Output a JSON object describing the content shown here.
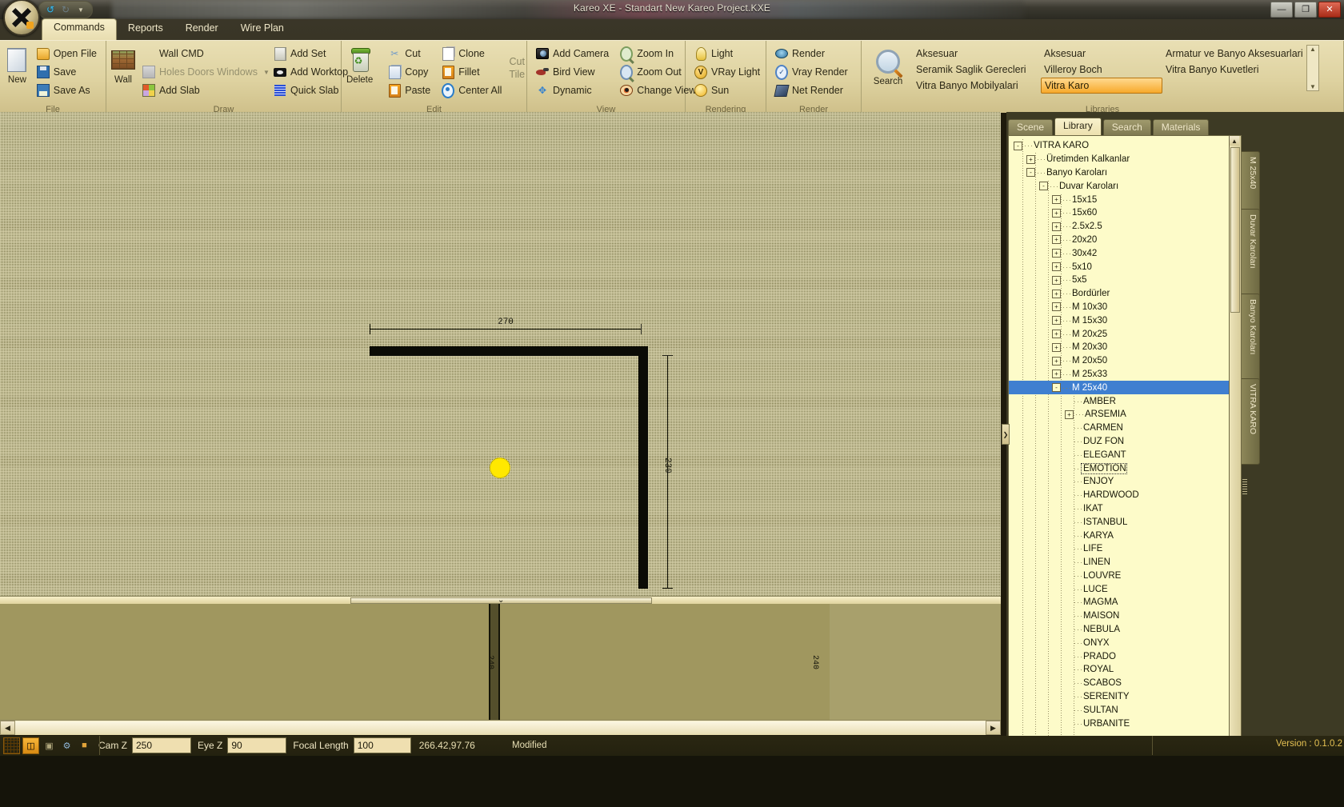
{
  "window": {
    "title": "Kareo XE - Standart  New Kareo Project.KXE",
    "buttons": {
      "minimize": "—",
      "maximize": "❐",
      "close": "✕"
    },
    "quick_access": {
      "undo": "↺",
      "redo": "↻",
      "more": "▼"
    }
  },
  "ribbon": {
    "tabs": [
      {
        "label": "Commands",
        "active": true
      },
      {
        "label": "Reports",
        "active": false
      },
      {
        "label": "Render",
        "active": false
      },
      {
        "label": "Wire Plan",
        "active": false
      }
    ],
    "groups": [
      {
        "name": "File",
        "label": "File",
        "big": {
          "label": "New",
          "icon": "new-document-icon"
        },
        "items": [
          {
            "label": "Open File",
            "icon": "open-folder-icon"
          },
          {
            "label": "Save",
            "icon": "floppy-disk-icon"
          },
          {
            "label": "Save As",
            "icon": "floppy-disk-plus-icon"
          }
        ]
      },
      {
        "name": "Draw",
        "label": "Draw",
        "big": {
          "label": "Wall",
          "icon": "brick-wall-icon"
        },
        "col1": [
          {
            "label": "Wall CMD",
            "icon": "none",
            "disabled": false
          },
          {
            "label": "Holes Doors Windows",
            "icon": "window-icon",
            "disabled": true,
            "caret": "▼"
          },
          {
            "label": "Add Slab",
            "icon": "slab-color-icon",
            "disabled": false
          }
        ],
        "col2": [
          {
            "label": "Add Set",
            "icon": "box-set-icon"
          },
          {
            "label": "Add Worktop",
            "icon": "worktop-icon"
          },
          {
            "label": "Quick Slab",
            "icon": "quick-slab-grid-icon"
          }
        ]
      },
      {
        "name": "Edit",
        "label": "Edit",
        "big": {
          "label": "Delete",
          "icon": "recycle-bin-icon"
        },
        "col1": [
          {
            "label": "Cut",
            "icon": "scissors-icon"
          },
          {
            "label": "Copy",
            "icon": "copy-pages-icon"
          },
          {
            "label": "Paste",
            "icon": "clipboard-icon"
          }
        ],
        "col2": [
          {
            "label": "Clone",
            "icon": "clone-icon"
          },
          {
            "label": "Fillet",
            "icon": "fillet-clipboard-icon"
          },
          {
            "label": "Center All",
            "icon": "center-target-icon"
          }
        ],
        "extra": {
          "line1": "Cut",
          "line2": "Tile"
        }
      },
      {
        "name": "View",
        "label": "View",
        "col1": [
          {
            "label": "Add Camera",
            "icon": "camera-icon"
          },
          {
            "label": "Bird View",
            "icon": "bird-icon"
          },
          {
            "label": "Dynamic",
            "icon": "move-arrows-icon"
          }
        ],
        "col2": [
          {
            "label": "Zoom In",
            "icon": "zoom-in-icon"
          },
          {
            "label": "Zoom Out",
            "icon": "zoom-out-icon"
          },
          {
            "label": "Change View",
            "icon": "eye-icon"
          }
        ]
      },
      {
        "name": "Rendering",
        "label": "Rendering",
        "col1": [
          {
            "label": "Light",
            "icon": "light-bulb-icon"
          },
          {
            "label": "VRay Light",
            "icon": "vray-light-icon"
          },
          {
            "label": "Sun",
            "icon": "sun-icon"
          }
        ]
      },
      {
        "name": "Render",
        "label": "Render",
        "col1": [
          {
            "label": "Render",
            "icon": "render-icon"
          },
          {
            "label": "Vray Render",
            "icon": "vray-render-icon"
          },
          {
            "label": "Net Render",
            "icon": "net-render-icon"
          }
        ]
      },
      {
        "name": "Libraries",
        "label": "Libraries",
        "big": {
          "label": "Search",
          "icon": "magnifier-icon"
        },
        "cells": [
          {
            "label": "Aksesuar",
            "selected": false
          },
          {
            "label": "Aksesuar",
            "selected": false
          },
          {
            "label": "Armatur ve Banyo Aksesuarlari",
            "selected": false
          },
          {
            "label": "Seramik Saglik Gerecleri",
            "selected": false
          },
          {
            "label": "Villeroy Boch",
            "selected": false
          },
          {
            "label": "Vitra Banyo Kuvetleri",
            "selected": false
          },
          {
            "label": "Vitra Banyo Mobilyalari",
            "selected": false
          },
          {
            "label": "Vitra Karo",
            "selected": true
          },
          {
            "label": "",
            "selected": false
          }
        ],
        "scroll": {
          "up": "▲",
          "down": "▼"
        }
      }
    ]
  },
  "canvas": {
    "dim_horizontal": "270",
    "dim_vertical": "230",
    "view3d_dim_left": "240",
    "view3d_dim_right": "240",
    "splitter_chevron": "⌄"
  },
  "panel": {
    "tabs": [
      {
        "label": "Scene",
        "active": false
      },
      {
        "label": "Library",
        "active": true
      },
      {
        "label": "Search",
        "active": false
      },
      {
        "label": "Materials",
        "active": false
      }
    ],
    "tree": [
      {
        "label": "VITRA KARO",
        "depth": 0,
        "box": "-",
        "dots": true
      },
      {
        "label": "Üretimden Kalkanlar",
        "depth": 1,
        "box": "+",
        "dots": true
      },
      {
        "label": "Banyo Karoları",
        "depth": 1,
        "box": "-",
        "dots": true
      },
      {
        "label": "Duvar Karoları",
        "depth": 2,
        "box": "-",
        "dots": true
      },
      {
        "label": "15x15",
        "depth": 3,
        "box": "+",
        "dots": true
      },
      {
        "label": "15x60",
        "depth": 3,
        "box": "+",
        "dots": true
      },
      {
        "label": "2.5x2.5",
        "depth": 3,
        "box": "+",
        "dots": true
      },
      {
        "label": "20x20",
        "depth": 3,
        "box": "+",
        "dots": true
      },
      {
        "label": "30x42",
        "depth": 3,
        "box": "+",
        "dots": true
      },
      {
        "label": "5x10",
        "depth": 3,
        "box": "+",
        "dots": true
      },
      {
        "label": "5x5",
        "depth": 3,
        "box": "+",
        "dots": true
      },
      {
        "label": "Bordürler",
        "depth": 3,
        "box": "+",
        "dots": true
      },
      {
        "label": "M 10x30",
        "depth": 3,
        "box": "+",
        "dots": true
      },
      {
        "label": "M 15x30",
        "depth": 3,
        "box": "+",
        "dots": true
      },
      {
        "label": "M 20x25",
        "depth": 3,
        "box": "+",
        "dots": true
      },
      {
        "label": "M 20x30",
        "depth": 3,
        "box": "+",
        "dots": true
      },
      {
        "label": "M 20x50",
        "depth": 3,
        "box": "+",
        "dots": true
      },
      {
        "label": "M 25x33",
        "depth": 3,
        "box": "+",
        "dots": true
      },
      {
        "label": "M 25x40",
        "depth": 3,
        "box": "-",
        "dots": true,
        "selected": true
      },
      {
        "label": "AMBER",
        "depth": 4,
        "box": "",
        "dots": true
      },
      {
        "label": "ARSEMIA",
        "depth": 4,
        "box": "+",
        "dots": true
      },
      {
        "label": "CARMEN",
        "depth": 4,
        "box": "",
        "dots": true
      },
      {
        "label": "DUZ FON",
        "depth": 4,
        "box": "",
        "dots": true
      },
      {
        "label": "ELEGANT",
        "depth": 4,
        "box": "",
        "dots": true
      },
      {
        "label": "EMOTION",
        "depth": 4,
        "box": "",
        "dots": true,
        "focused": true
      },
      {
        "label": "ENJOY",
        "depth": 4,
        "box": "",
        "dots": true
      },
      {
        "label": "HARDWOOD",
        "depth": 4,
        "box": "",
        "dots": true
      },
      {
        "label": "IKAT",
        "depth": 4,
        "box": "",
        "dots": true
      },
      {
        "label": "ISTANBUL",
        "depth": 4,
        "box": "",
        "dots": true
      },
      {
        "label": "KARYA",
        "depth": 4,
        "box": "",
        "dots": true
      },
      {
        "label": "LIFE",
        "depth": 4,
        "box": "",
        "dots": true
      },
      {
        "label": "LINEN",
        "depth": 4,
        "box": "",
        "dots": true
      },
      {
        "label": "LOUVRE",
        "depth": 4,
        "box": "",
        "dots": true
      },
      {
        "label": "LUCE",
        "depth": 4,
        "box": "",
        "dots": true
      },
      {
        "label": "MAGMA",
        "depth": 4,
        "box": "",
        "dots": true
      },
      {
        "label": "MAISON",
        "depth": 4,
        "box": "",
        "dots": true
      },
      {
        "label": "NEBULA",
        "depth": 4,
        "box": "",
        "dots": true
      },
      {
        "label": "ONYX",
        "depth": 4,
        "box": "",
        "dots": true
      },
      {
        "label": "PRADO",
        "depth": 4,
        "box": "",
        "dots": true
      },
      {
        "label": "ROYAL",
        "depth": 4,
        "box": "",
        "dots": true
      },
      {
        "label": "SCABOS",
        "depth": 4,
        "box": "",
        "dots": true
      },
      {
        "label": "SERENITY",
        "depth": 4,
        "box": "",
        "dots": true
      },
      {
        "label": "SULTAN",
        "depth": 4,
        "box": "",
        "dots": true
      },
      {
        "label": "URBANITE",
        "depth": 4,
        "box": "",
        "dots": true
      }
    ],
    "vertical_tabs": [
      {
        "label": "M 25x40"
      },
      {
        "label": "Duvar Karoları"
      },
      {
        "label": "Banyo Karoları"
      },
      {
        "label": "VITRA KARO"
      }
    ],
    "collapse_arrow": "❯"
  },
  "statusbar": {
    "icons": [
      "grid-snap-icon",
      "ortho-snap-icon",
      "camera-icon",
      "settings-gear-icon",
      "paint-icon"
    ],
    "cam_z_label": "Cam Z",
    "cam_z_value": "250",
    "eye_z_label": "Eye Z",
    "eye_z_value": "90",
    "focal_label": "Focal Length",
    "focal_value": "100",
    "coordinates": "266.42,97.76",
    "state": "Modified",
    "version": "Version : 0.1.0.2"
  },
  "colors": {
    "accent": "#f7a92b",
    "selection": "#3f7fd0",
    "canvas": "#6a6638",
    "panel": "#fdfbc9"
  }
}
